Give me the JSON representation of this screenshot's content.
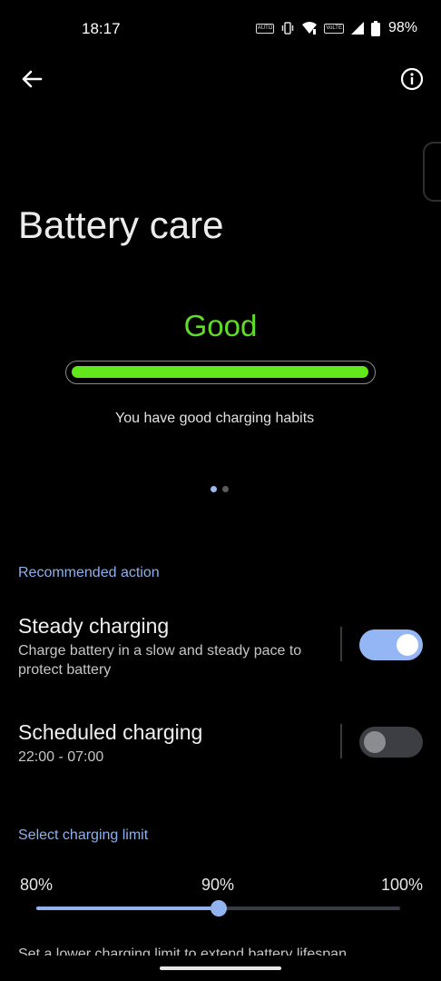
{
  "status_bar": {
    "time": "18:17",
    "battery_percent": "98%",
    "icons": [
      "auto-brightness-icon",
      "vibrate-icon",
      "wifi-icon",
      "volte-icon",
      "signal-icon",
      "battery-icon"
    ]
  },
  "header": {
    "back_icon": "arrow-left-icon",
    "info_icon": "info-icon"
  },
  "page": {
    "title": "Battery care"
  },
  "health": {
    "status": "Good",
    "level": 1.0,
    "message": "You have good charging habits",
    "color": "#5edc26"
  },
  "pager": {
    "count": 2,
    "active_index": 0
  },
  "recommended": {
    "header": "Recommended action",
    "items": [
      {
        "title": "Steady charging",
        "subtitle": "Charge battery in a slow and steady pace to protect battery",
        "enabled": true
      },
      {
        "title": "Scheduled charging",
        "subtitle": "22:00 - 07:00",
        "enabled": false
      }
    ]
  },
  "charging_limit": {
    "header": "Select charging limit",
    "options": [
      "80%",
      "90%",
      "100%"
    ],
    "selected": "90%",
    "description": "Set a lower charging limit to extend battery lifespan"
  },
  "colors": {
    "accent": "#93b3ee",
    "good": "#5edc26",
    "background": "#000000"
  }
}
